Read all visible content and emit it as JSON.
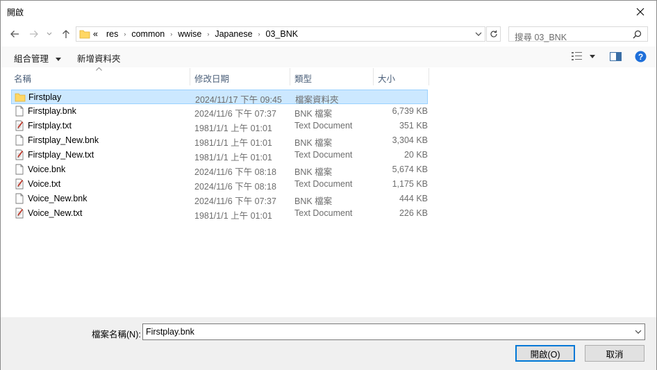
{
  "window": {
    "title": "開啟"
  },
  "address": {
    "crumbs": [
      "«",
      "res",
      "common",
      "wwise",
      "Japanese",
      "03_BNK"
    ]
  },
  "search": {
    "placeholder": "搜尋 03_BNK"
  },
  "toolbar": {
    "organize": "組合管理",
    "new_folder": "新增資料夾"
  },
  "columns": {
    "name": "名稱",
    "date": "修改日期",
    "type": "類型",
    "size": "大小"
  },
  "files": [
    {
      "icon": "folder-icon",
      "name": "Firstplay",
      "date": "2024/11/17 下午 09:45",
      "type": "檔案資料夾",
      "size": ""
    },
    {
      "icon": "file-icon",
      "name": "Firstplay.bnk",
      "date": "2024/11/6 下午 07:37",
      "type": "BNK 檔案",
      "size": "6,739 KB"
    },
    {
      "icon": "text-document-icon",
      "name": "Firstplay.txt",
      "date": "1981/1/1 上午 01:01",
      "type": "Text Document",
      "size": "351 KB"
    },
    {
      "icon": "file-icon",
      "name": "Firstplay_New.bnk",
      "date": "1981/1/1 上午 01:01",
      "type": "BNK 檔案",
      "size": "3,304 KB"
    },
    {
      "icon": "text-document-icon",
      "name": "Firstplay_New.txt",
      "date": "1981/1/1 上午 01:01",
      "type": "Text Document",
      "size": "20 KB"
    },
    {
      "icon": "file-icon",
      "name": "Voice.bnk",
      "date": "2024/11/6 下午 08:18",
      "type": "BNK 檔案",
      "size": "5,674 KB"
    },
    {
      "icon": "text-document-icon",
      "name": "Voice.txt",
      "date": "2024/11/6 下午 08:18",
      "type": "Text Document",
      "size": "1,175 KB"
    },
    {
      "icon": "file-icon",
      "name": "Voice_New.bnk",
      "date": "2024/11/6 下午 07:37",
      "type": "BNK 檔案",
      "size": "444 KB"
    },
    {
      "icon": "text-document-icon",
      "name": "Voice_New.txt",
      "date": "1981/1/1 上午 01:01",
      "type": "Text Document",
      "size": "226 KB"
    }
  ],
  "filename": {
    "label": "檔案名稱(N):",
    "value": "Firstplay.bnk"
  },
  "buttons": {
    "open": "開啟(O)",
    "cancel": "取消"
  },
  "colors": {
    "accent": "#0078d7",
    "selection": "#cce8ff",
    "help": "#1e6fd9"
  }
}
